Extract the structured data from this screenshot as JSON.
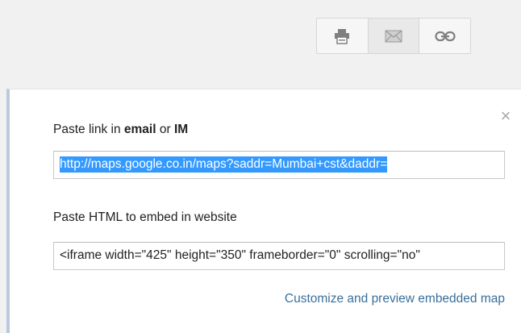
{
  "toolbar": {
    "buttons": [
      {
        "icon": "print-icon"
      },
      {
        "icon": "email-icon"
      },
      {
        "icon": "link-icon"
      }
    ]
  },
  "panel": {
    "email_label_prefix": "Paste link in ",
    "email_label_bold1": "email",
    "email_label_mid": " or ",
    "email_label_bold2": "IM",
    "link_value": "http://maps.google.co.in/maps?saddr=Mumbai+cst&daddr=",
    "embed_label": "Paste HTML to embed in website",
    "embed_value": "<iframe width=\"425\" height=\"350\" frameborder=\"0\" scrolling=\"no\"",
    "customize_link": "Customize and preview embedded map"
  },
  "colors": {
    "selection": "#3399ff",
    "link": "#3a6f9a",
    "panel_border": "#b9c9de"
  }
}
